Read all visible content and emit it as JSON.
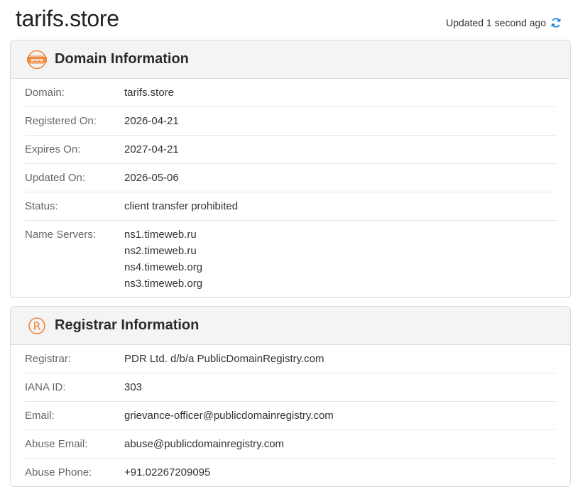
{
  "page": {
    "title": "tarifs.store",
    "updated": "Updated 1 second ago"
  },
  "domain_card": {
    "title": "Domain Information",
    "icon": "www-icon",
    "rows": [
      {
        "label": "Domain:",
        "value": "tarifs.store"
      },
      {
        "label": "Registered On:",
        "value": "2026-04-21"
      },
      {
        "label": "Expires On:",
        "value": "2027-04-21"
      },
      {
        "label": "Updated On:",
        "value": "2026-05-06"
      },
      {
        "label": "Status:",
        "value": "client transfer prohibited"
      }
    ],
    "name_servers": {
      "label": "Name Servers:",
      "values": [
        "ns1.timeweb.ru",
        "ns2.timeweb.ru",
        "ns4.timeweb.org",
        "ns3.timeweb.org"
      ]
    }
  },
  "registrar_card": {
    "title": "Registrar Information",
    "icon": "registered-icon",
    "rows": [
      {
        "label": "Registrar:",
        "value": "PDR Ltd. d/b/a PublicDomainRegistry.com"
      },
      {
        "label": "IANA ID:",
        "value": "303"
      },
      {
        "label": "Email:",
        "value": "grievance-officer@publicdomainregistry.com"
      },
      {
        "label": "Abuse Email:",
        "value": "abuse@publicdomainregistry.com"
      },
      {
        "label": "Abuse Phone:",
        "value": "+91.02267209095"
      }
    ]
  },
  "colors": {
    "accent_orange": "#f0883e",
    "refresh_blue": "#1e88e5"
  }
}
